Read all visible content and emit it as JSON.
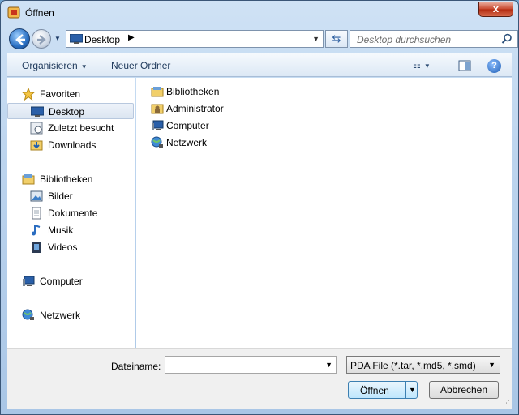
{
  "window": {
    "title": "Öffnen",
    "close_label": "x"
  },
  "nav": {
    "address_text": "Desktop",
    "search_placeholder": "Desktop durchsuchen"
  },
  "toolbar": {
    "organize": "Organisieren",
    "new_folder": "Neuer Ordner"
  },
  "sidebar": {
    "favorites": {
      "header": "Favoriten",
      "items": [
        "Desktop",
        "Zuletzt besucht",
        "Downloads"
      ]
    },
    "libraries": {
      "header": "Bibliotheken",
      "items": [
        "Bilder",
        "Dokumente",
        "Musik",
        "Videos"
      ]
    },
    "computer": "Computer",
    "network": "Netzwerk"
  },
  "content": {
    "items": [
      "Bibliotheken",
      "Administrator",
      "Computer",
      "Netzwerk"
    ]
  },
  "footer": {
    "filename_label": "Dateiname:",
    "filename_value": "",
    "filetype_value": "PDA File (*.tar, *.md5, *.smd)",
    "open_label": "Öffnen",
    "cancel_label": "Abbrechen"
  },
  "icons": {
    "app": "app-icon",
    "back": "back-arrow-icon",
    "forward": "forward-arrow-icon",
    "refresh": "refresh-icon",
    "search": "search-icon",
    "help": "help-icon",
    "view": "view-options-icon",
    "preview": "preview-pane-icon"
  }
}
